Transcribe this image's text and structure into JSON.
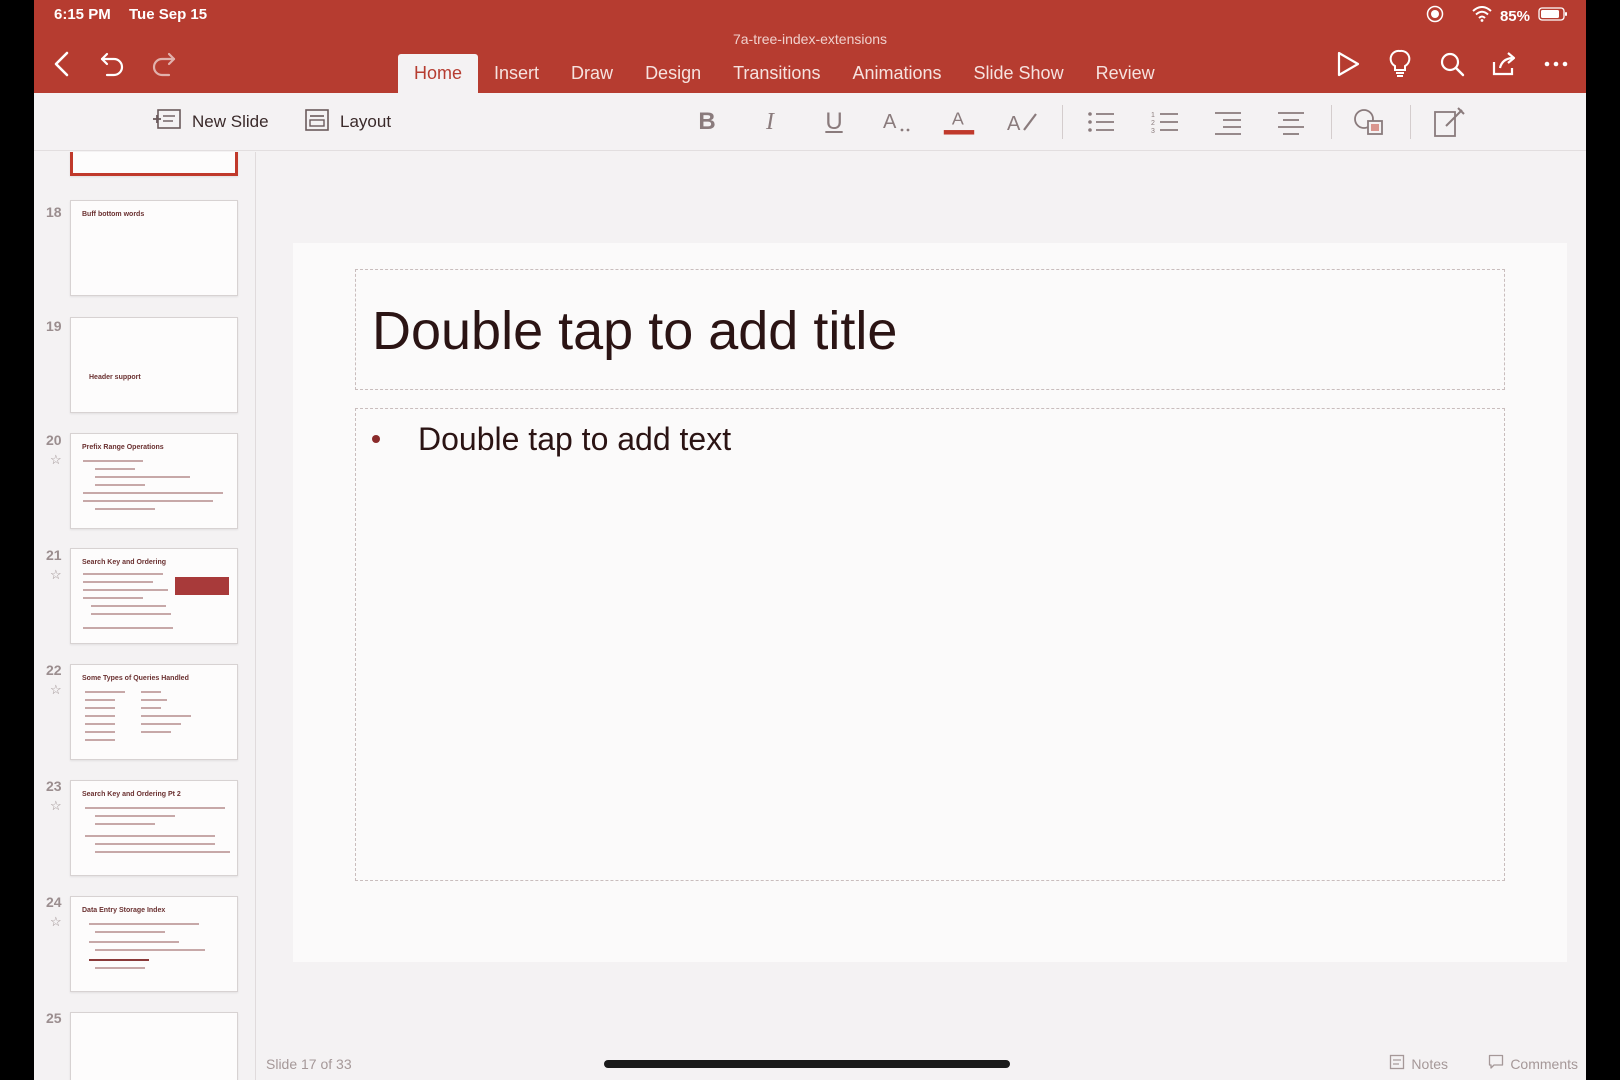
{
  "status": {
    "time": "6:15 PM",
    "date": "Tue Sep 15",
    "battery": "85%"
  },
  "document": {
    "title": "7a-tree-index-extensions"
  },
  "tabs": [
    {
      "label": "Home",
      "active": true
    },
    {
      "label": "Insert"
    },
    {
      "label": "Draw"
    },
    {
      "label": "Design"
    },
    {
      "label": "Transitions"
    },
    {
      "label": "Animations"
    },
    {
      "label": "Slide Show"
    },
    {
      "label": "Review"
    }
  ],
  "ribbon": {
    "new_slide": "New Slide",
    "layout": "Layout",
    "font_color": "#c0392b"
  },
  "thumbnails": [
    {
      "num": "",
      "title": ""
    },
    {
      "num": "18",
      "title": "Buff bottom words"
    },
    {
      "num": "19",
      "title": "Header support"
    },
    {
      "num": "20",
      "title": "Prefix Range Operations",
      "star": "☆"
    },
    {
      "num": "21",
      "title": "Search Key and Ordering",
      "star": "☆"
    },
    {
      "num": "22",
      "title": "Some Types of Queries Handled",
      "star": "☆"
    },
    {
      "num": "23",
      "title": "Search Key and Ordering Pt 2",
      "star": "☆"
    },
    {
      "num": "24",
      "title": "Data Entry Storage Index",
      "star": "☆"
    },
    {
      "num": "25",
      "title": ""
    }
  ],
  "slide": {
    "title_placeholder": "Double tap to add title",
    "body_placeholder": "Double tap to add text"
  },
  "footer": {
    "slide_count": "Slide 17 of 33",
    "notes": "Notes",
    "comments": "Comments"
  },
  "colors": {
    "accent": "#b63c30",
    "background": "#f4f2f3"
  }
}
